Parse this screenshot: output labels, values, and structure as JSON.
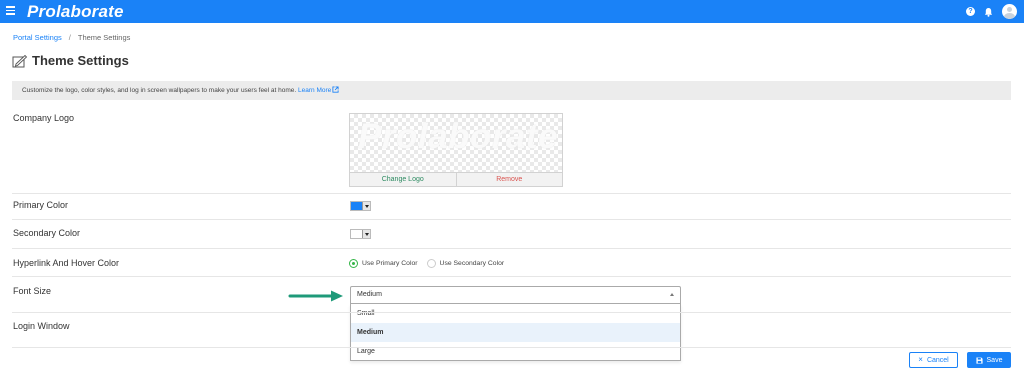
{
  "header": {
    "brand": "Prolaborate",
    "help_icon_glyph": "?",
    "colors": {
      "bar": "#1a82f7"
    }
  },
  "breadcrumb": {
    "parent": "Portal Settings",
    "separator": "/",
    "current": "Theme Settings"
  },
  "page": {
    "title": "Theme Settings",
    "info_text": "Customize the logo, color styles, and log in screen wallpapers to make your users feel at home.",
    "learn_more": "Learn More"
  },
  "settings": {
    "company_logo": {
      "label": "Company Logo",
      "logo_text": "Prolaborate",
      "change_label": "Change Logo",
      "remove_label": "Remove"
    },
    "primary_color": {
      "label": "Primary Color",
      "value": "#1a82f7"
    },
    "secondary_color": {
      "label": "Secondary Color",
      "value": "#ffffff"
    },
    "hyperlink_color": {
      "label": "Hyperlink And Hover Color",
      "options": [
        "Use Primary Color",
        "Use Secondary Color"
      ],
      "selected": "Use Primary Color"
    },
    "font_size": {
      "label": "Font Size",
      "selected": "Medium",
      "options": [
        "Small",
        "Medium",
        "Large"
      ]
    },
    "login_window": {
      "label": "Login Window"
    }
  },
  "actions": {
    "cancel_label": "Cancel",
    "save_label": "Save",
    "cancel_glyph": "×"
  },
  "annotation": {
    "arrow_color": "#1e9a79"
  }
}
